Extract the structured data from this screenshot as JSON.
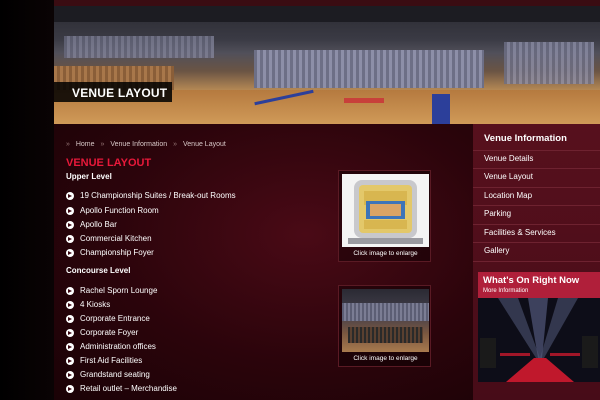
{
  "hero": {
    "title": "VENUE LAYOUT"
  },
  "breadcrumb": {
    "items": [
      "Home",
      "Venue Information",
      "Venue Layout"
    ]
  },
  "content": {
    "heading": "VENUE LAYOUT",
    "sections": [
      {
        "title": "Upper Level",
        "items": [
          "19 Championship Suites / Break-out Rooms",
          "Apollo Function Room",
          "Apollo Bar",
          "Commercial Kitchen",
          "Championship Foyer"
        ]
      },
      {
        "title": "Concourse Level",
        "items": [
          "Rachel Sporn Lounge",
          "4 Kiosks",
          "Corporate Entrance",
          "Corporate Foyer",
          "Administration offices",
          "First Aid Facilities",
          "Grandstand seating",
          "Retail outlet – Merchandise"
        ]
      }
    ],
    "thumbnails": [
      {
        "caption": "Click image to enlarge"
      },
      {
        "caption": "Click image to enlarge"
      }
    ]
  },
  "sidebar": {
    "title": "Venue Information",
    "items": [
      "Venue Details",
      "Venue Layout",
      "Location Map",
      "Parking",
      "Facilities & Services",
      "Gallery"
    ]
  },
  "promo": {
    "title": "What's On Right Now",
    "more": "More Information"
  },
  "colors": {
    "accent": "#e8193a",
    "sidebar": "#57101d",
    "promo": "#b01f3a"
  }
}
